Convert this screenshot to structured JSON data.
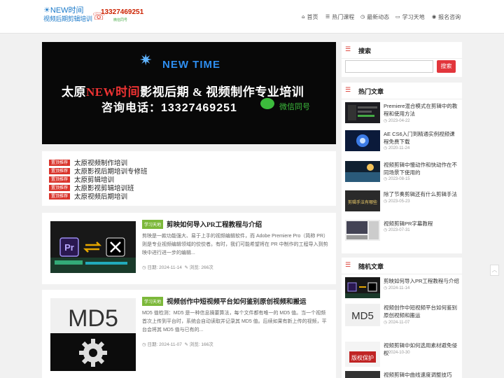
{
  "header": {
    "logo_line1": "NEW时间",
    "logo_line2": "视频后期剪辑培训",
    "phone": "13327469251",
    "phone_wechat": "微信同号",
    "nav": [
      {
        "icon": "home-icon",
        "glyph": "⌂",
        "label": "首页"
      },
      {
        "icon": "list-icon",
        "glyph": "☰",
        "label": "热门课程"
      },
      {
        "icon": "clock-icon",
        "glyph": "◷",
        "label": "最新动态"
      },
      {
        "icon": "monitor-icon",
        "glyph": "▭",
        "label": "学习天地"
      },
      {
        "icon": "chat-icon",
        "glyph": "◉",
        "label": "报名咨询"
      }
    ]
  },
  "hero": {
    "brand": "NEW TIME",
    "line1_a": "太原",
    "line1_b": "NEW时间",
    "line1_c": "影视后期 & 视频制作专业培训",
    "line2": "咨询电话：13327469251",
    "wechat": "微信同号",
    "dots": [
      "1",
      "2",
      "3"
    ],
    "active_dot": 0
  },
  "recommend": {
    "tag": "置顶推荐",
    "items": [
      "太原视频制作培训",
      "太原影视后期培训专修班",
      "太原剪辑培训",
      "太原影视剪辑培训班",
      "太原视频后期培训"
    ]
  },
  "posts": [
    {
      "tag": "学习天地",
      "title": "剪映如何导入PR工程教程与介绍",
      "excerpt": "剪映是一款功能强大、易于上手的视频编辑软件，而 Adobe Premiere Pro（简称 PR）则是专业视频编辑领域的佼佼者。有时，我们可能希望将在 PR 中制作的工程导入到剪映中进行进一步的编辑...",
      "date_label": "日期:",
      "date": "2024-11-14",
      "views_label": "浏览:",
      "views": "266次"
    },
    {
      "tag": "学习天地",
      "title": "视频创作中短视频平台如何鉴别原创视频和搬运",
      "excerpt": "MD5 值检测：MD5 是一种信息摘要算法，每个文件都有唯一的 MD5 值。当一个视频首次上传到平台时，系统会自动读取并记录其 MD5 值。后续如果有新上传的视频，平台会将其 MD5 值与已有的...",
      "thumb_text": "MD5",
      "date_label": "日期:",
      "date": "2024-11-07",
      "views_label": "浏览:",
      "views": "166次"
    }
  ],
  "sidebar": {
    "search_title": "搜索",
    "search_button": "搜索",
    "search_placeholder": "",
    "hot_title": "热门文章",
    "hot": [
      {
        "title": "Premiere混合模式在剪辑中的教程和使用方法",
        "date": "2023-04-22"
      },
      {
        "title": "AE CS6入门到精通实例视频课程免费下载",
        "date": "2020-11-24"
      },
      {
        "title": "视频剪辑中慢动作和快动作在不同场景下使用的",
        "date": "2023-08-15"
      },
      {
        "title": "除了节奏剪辑还有什么剪辑手法",
        "date": "2023-05-23",
        "thumb_text": "剪辑手法有哪些"
      },
      {
        "title": "视频剪辑PR字幕教程",
        "date": "2023-07-31"
      }
    ],
    "pick_title": "随机文章",
    "picks": [
      {
        "title": "剪映如何导入PR工程教程与介绍",
        "date": "2024-11-14"
      },
      {
        "title": "视频创作中短视频平台如何鉴别原创视频和搬运",
        "date": "2024-11-07",
        "thumb_text": "MD5"
      },
      {
        "title": "视频剪辑中如何选用素材避免侵权",
        "date": "2024-10-30",
        "thumb_text": "版权保护"
      },
      {
        "title": "视频剪辑中曲线速度调整技巧",
        "date": ""
      }
    ]
  }
}
